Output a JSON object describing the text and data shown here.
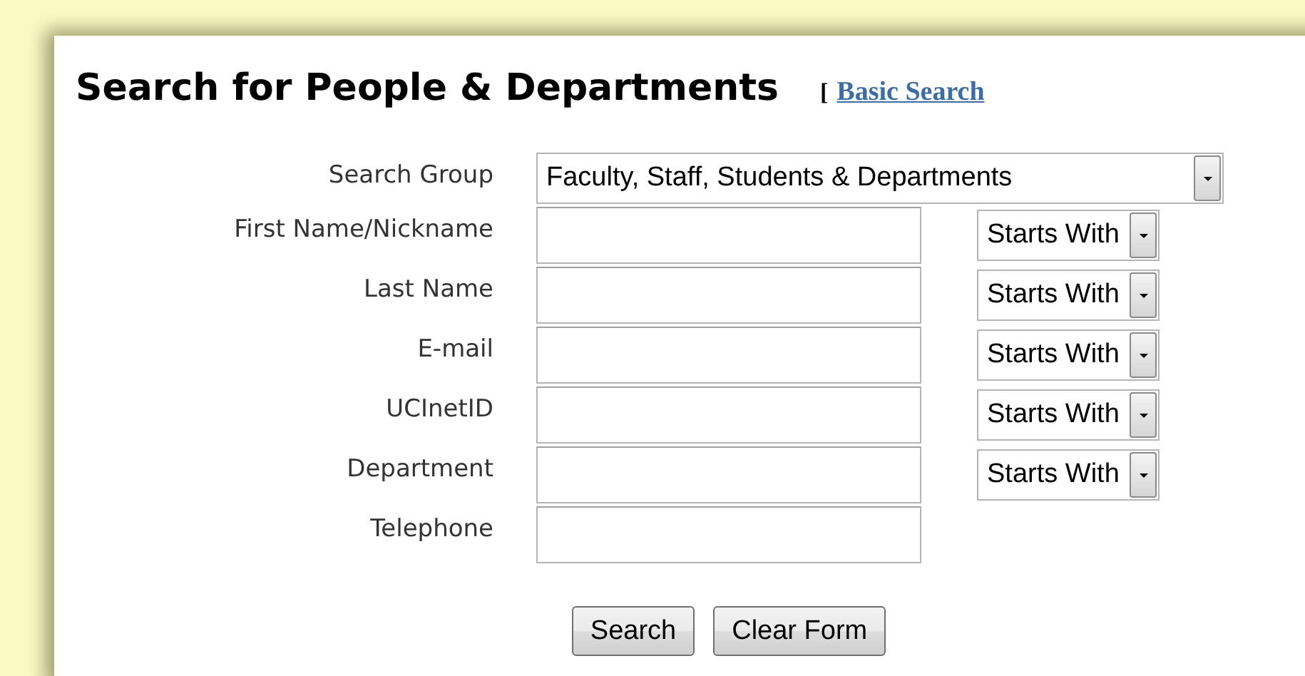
{
  "title": "Search for People & Departments",
  "link_bracket": "[",
  "basic_search_link": "Basic Search",
  "fields": [
    {
      "label": "Search Group",
      "kind": "select",
      "value": "Faculty, Staff, Students & Departments"
    },
    {
      "label": "First Name/Nickname",
      "kind": "text",
      "match": "Starts With"
    },
    {
      "label": "Last Name",
      "kind": "text",
      "match": "Starts With"
    },
    {
      "label": "E-mail",
      "kind": "text",
      "match": "Starts With"
    },
    {
      "label": "UCInetID",
      "kind": "text",
      "match": "Starts With"
    },
    {
      "label": "Department",
      "kind": "text",
      "match": "Starts With"
    },
    {
      "label": "Telephone",
      "kind": "text"
    }
  ],
  "buttons": [
    "Search",
    "Clear Form"
  ]
}
